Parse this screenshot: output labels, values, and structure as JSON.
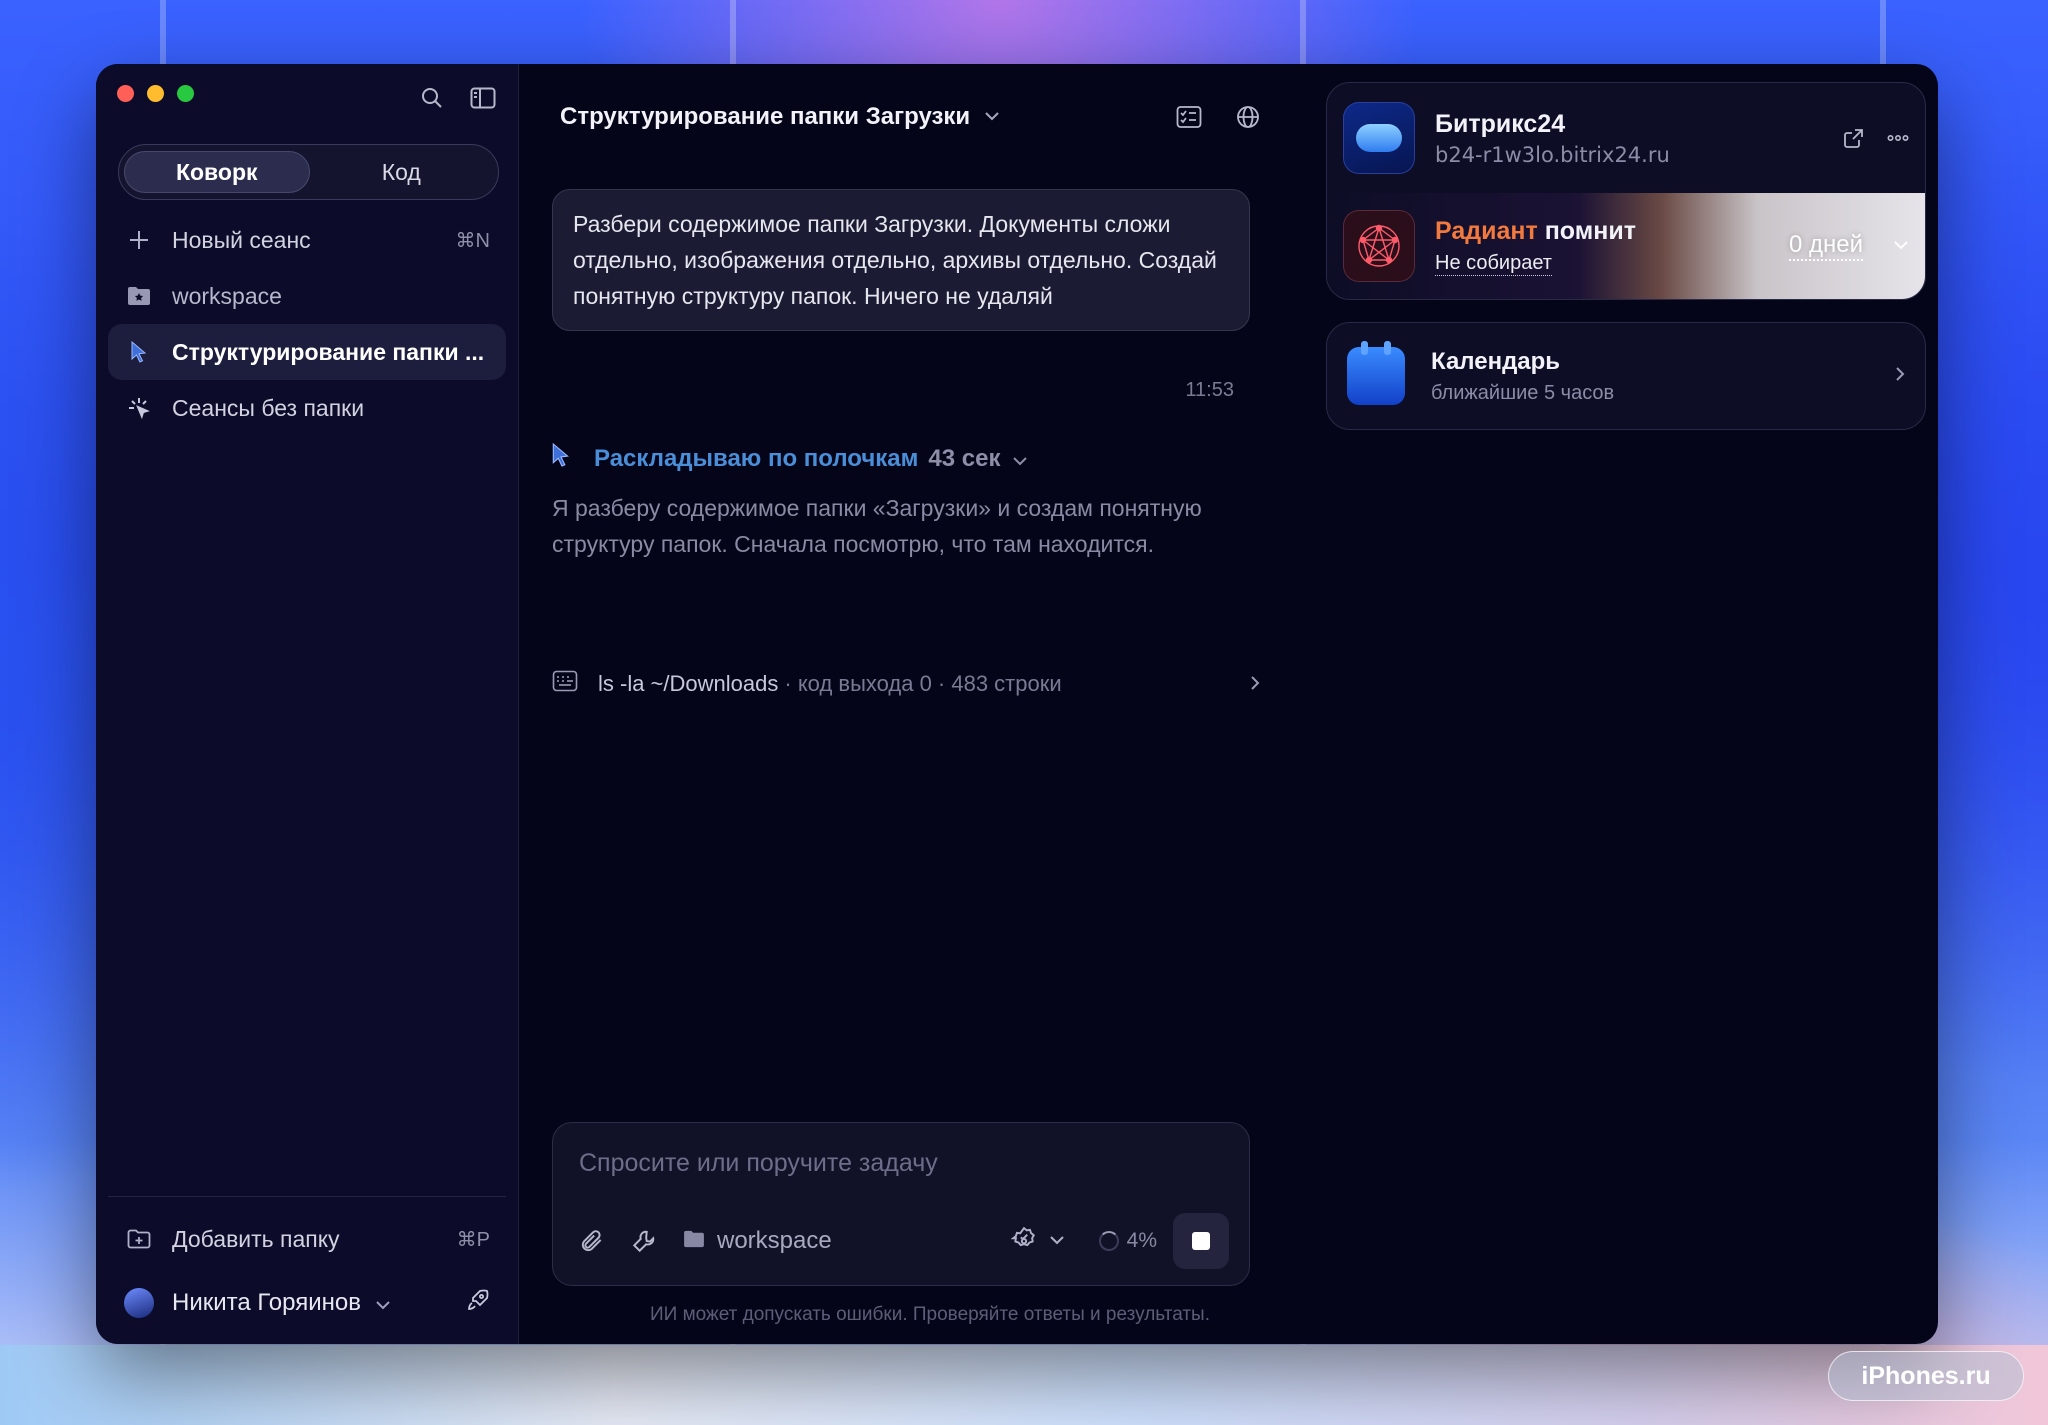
{
  "sidebar": {
    "modes": [
      "Коворк",
      "Код"
    ],
    "active_mode": "Коворк",
    "new_session": {
      "label": "Новый сеанс",
      "shortcut": "⌘N"
    },
    "items": [
      {
        "label": "workspace",
        "icon": "folder-star-icon"
      },
      {
        "label": "Структурирование папки ...",
        "icon": "cursor-icon",
        "active": true
      },
      {
        "label": "Сеансы без папки",
        "icon": "sparkle-icon"
      }
    ],
    "add_folder": {
      "label": "Добавить папку",
      "shortcut": "⌘P"
    },
    "user": {
      "name": "Никита Горяинов"
    }
  },
  "main": {
    "title": "Структурирование папки Загрузки",
    "user_message": "Разбери содержимое папки Загрузки. Документы сложи отдельно, изображения отдельно, архивы отдельно. Создай понятную структуру папок. Ничего не удаляй",
    "message_time": "11:53",
    "status": {
      "text": "Раскладываю по полочкам",
      "duration": "43 сек"
    },
    "assistant_text": "Я разберу содержимое папки «Загрузки» и создам понятную структуру папок. Сначала посмотрю, что там находится.",
    "tool_call": {
      "command": "ls -la ~/Downloads",
      "meta": "· код выхода 0 · 483 строки"
    },
    "composer": {
      "placeholder": "Спросите или поручите задачу",
      "folder": "workspace",
      "context_usage": "4%"
    },
    "disclaimer": "ИИ может допускать ошибки. Проверяйте ответы и результаты."
  },
  "right": {
    "bitrix": {
      "title": "Битрикс24",
      "subtitle": "b24-r1w3lo.bitrix24.ru"
    },
    "radiant": {
      "name_accent": "Радиант",
      "name_rest": "помнит",
      "status": "Не собирает",
      "days": "0 дней"
    },
    "calendar": {
      "title": "Календарь",
      "subtitle": "ближайшие 5 часов"
    }
  },
  "watermark": "iPhones.ru",
  "colors": {
    "accent_status": "#4a8ed8",
    "radiant_accent": "#f27a3e",
    "window_bg": "#05051a"
  }
}
